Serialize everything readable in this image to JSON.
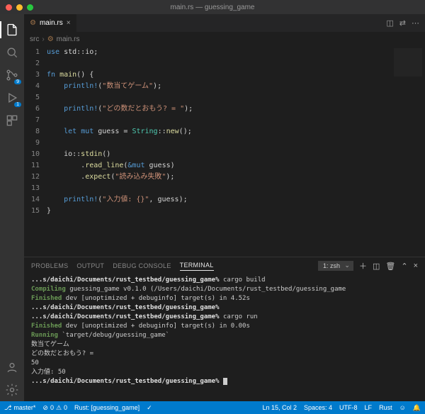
{
  "window": {
    "title": "main.rs — guessing_game"
  },
  "tab": {
    "filename": "main.rs"
  },
  "breadcrumbs": {
    "folder": "src",
    "file": "main.rs"
  },
  "activitybar": {
    "scm_badge": "9",
    "debug_badge": "1"
  },
  "code": {
    "lines": [
      {
        "n": 1,
        "seg": [
          [
            "kw",
            "use"
          ],
          [
            "pn",
            " std"
          ],
          [
            "pn",
            "::"
          ],
          [
            "pn",
            "io"
          ],
          [
            "pn",
            ";"
          ]
        ]
      },
      {
        "n": 2,
        "seg": []
      },
      {
        "n": 3,
        "seg": [
          [
            "kw",
            "fn"
          ],
          [
            "pn",
            " "
          ],
          [
            "fn",
            "main"
          ],
          [
            "pn",
            "() "
          ],
          [
            "pn",
            "{"
          ]
        ]
      },
      {
        "n": 4,
        "seg": [
          [
            "pn",
            "    "
          ],
          [
            "mac",
            "println!"
          ],
          [
            "pn",
            "("
          ],
          [
            "st",
            "\"数当てゲーム\""
          ],
          [
            "pn",
            ");"
          ]
        ]
      },
      {
        "n": 5,
        "seg": []
      },
      {
        "n": 6,
        "seg": [
          [
            "pn",
            "    "
          ],
          [
            "mac",
            "println!"
          ],
          [
            "pn",
            "("
          ],
          [
            "st",
            "\"どの数だとおもう? = \""
          ],
          [
            "pn",
            ");"
          ]
        ]
      },
      {
        "n": 7,
        "seg": []
      },
      {
        "n": 8,
        "seg": [
          [
            "pn",
            "    "
          ],
          [
            "kw",
            "let"
          ],
          [
            "pn",
            " "
          ],
          [
            "kw",
            "mut"
          ],
          [
            "pn",
            " guess = "
          ],
          [
            "ty",
            "String"
          ],
          [
            "pn",
            "::"
          ],
          [
            "mt",
            "new"
          ],
          [
            "pn",
            "();"
          ]
        ]
      },
      {
        "n": 9,
        "seg": []
      },
      {
        "n": 10,
        "seg": [
          [
            "pn",
            "    io::"
          ],
          [
            "mt",
            "stdin"
          ],
          [
            "pn",
            "()"
          ]
        ]
      },
      {
        "n": 11,
        "seg": [
          [
            "pn",
            "        ."
          ],
          [
            "mt",
            "read_line"
          ],
          [
            "pn",
            "("
          ],
          [
            "kw",
            "&mut"
          ],
          [
            "pn",
            " guess)"
          ]
        ]
      },
      {
        "n": 12,
        "seg": [
          [
            "pn",
            "        ."
          ],
          [
            "mt",
            "expect"
          ],
          [
            "pn",
            "("
          ],
          [
            "st",
            "\"読み込み失敗\""
          ],
          [
            "pn",
            ");"
          ]
        ]
      },
      {
        "n": 13,
        "seg": []
      },
      {
        "n": 14,
        "seg": [
          [
            "pn",
            "    "
          ],
          [
            "mac",
            "println!"
          ],
          [
            "pn",
            "("
          ],
          [
            "st",
            "\"入力値: {}\""
          ],
          [
            "pn",
            ", guess);"
          ]
        ]
      },
      {
        "n": 15,
        "seg": [
          [
            "pn",
            "}"
          ]
        ]
      }
    ]
  },
  "panel": {
    "tabs": {
      "problems": "PROBLEMS",
      "output": "OUTPUT",
      "debug": "DEBUG CONSOLE",
      "terminal": "TERMINAL"
    },
    "shell": "1: zsh"
  },
  "terminal": {
    "lines": [
      [
        [
          "path",
          "...s/daichi/Documents/rust_testbed/guessing_game"
        ],
        [
          "b",
          "% "
        ],
        [
          "",
          "cargo build"
        ]
      ],
      [
        [
          "g",
          "   Compiling"
        ],
        [
          "",
          " guessing_game v0.1.0 (/Users/daichi/Documents/rust_testbed/guessing_game"
        ]
      ],
      [
        [
          "g",
          "    Finished"
        ],
        [
          "",
          " dev [unoptimized + debuginfo] target(s) in 4.52s"
        ]
      ],
      [
        [
          "path",
          "...s/daichi/Documents/rust_testbed/guessing_game"
        ],
        [
          "b",
          "%"
        ]
      ],
      [
        [
          "path",
          "...s/daichi/Documents/rust_testbed/guessing_game"
        ],
        [
          "b",
          "% "
        ],
        [
          "",
          "cargo run"
        ]
      ],
      [
        [
          "g",
          "    Finished"
        ],
        [
          "",
          " dev [unoptimized + debuginfo] target(s) in 0.00s"
        ]
      ],
      [
        [
          "g",
          "     Running"
        ],
        [
          "",
          " `target/debug/guessing_game`"
        ]
      ],
      [
        [
          "",
          "数当てゲーム"
        ]
      ],
      [
        [
          "",
          "どの数だとおもう? ="
        ]
      ],
      [
        [
          "",
          "50"
        ]
      ],
      [
        [
          "",
          "入力値: 50"
        ]
      ],
      [
        [
          "",
          ""
        ]
      ],
      [
        [
          "path",
          "...s/daichi/Documents/rust_testbed/guessing_game"
        ],
        [
          "b",
          "% "
        ],
        [
          "cursor",
          ""
        ]
      ]
    ]
  },
  "status": {
    "branch": "master*",
    "errors": "0",
    "warnings": "0",
    "rust": "Rust: [guessing_game]",
    "lncol": "Ln 15, Col 2",
    "spaces": "Spaces: 4",
    "encoding": "UTF-8",
    "eol": "LF",
    "lang": "Rust"
  }
}
